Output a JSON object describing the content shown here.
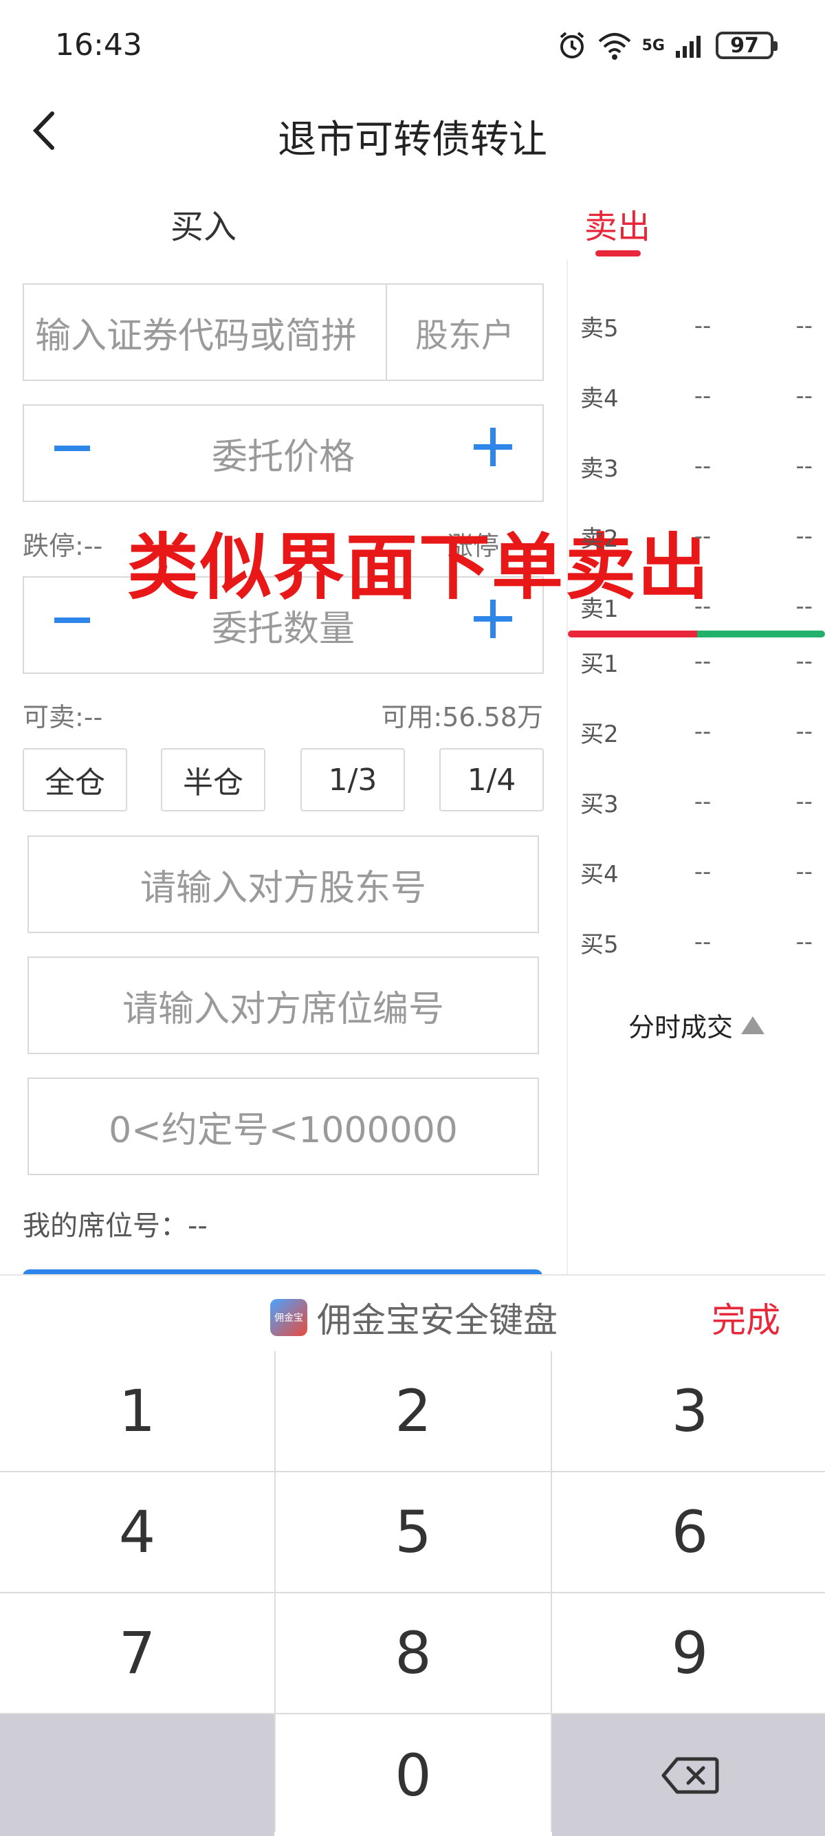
{
  "status_bar": {
    "time": "16:43",
    "network": "5G",
    "battery": "97"
  },
  "header": {
    "title": "退市可转债转让"
  },
  "tabs": [
    {
      "label": "买入"
    },
    {
      "label": "卖出"
    }
  ],
  "form": {
    "code_placeholder": "输入证券代码或简拼",
    "holder_account": "股东户",
    "price_placeholder": "委托价格",
    "quantity_placeholder": "委托数量",
    "limit_down": "跌停:--",
    "limit_up": "涨停",
    "sellable": "可卖:--",
    "available": "可用:56.58万",
    "ratios": [
      "全仓",
      "半仓",
      "1/3",
      "1/4"
    ],
    "counterparty_holder_placeholder": "请输入对方股东号",
    "counterparty_seat_placeholder": "请输入对方席位编号",
    "agreement_placeholder": "0<约定号<1000000",
    "my_seat": "我的席位号：--"
  },
  "overlay_text": "类似界面下单卖出",
  "order_book": {
    "asks": [
      {
        "label": "卖5",
        "price": "--",
        "volume": "--"
      },
      {
        "label": "卖4",
        "price": "--",
        "volume": "--"
      },
      {
        "label": "卖3",
        "price": "--",
        "volume": "--"
      },
      {
        "label": "卖2",
        "price": "--",
        "volume": "--"
      },
      {
        "label": "卖1",
        "price": "--",
        "volume": "--"
      }
    ],
    "bids": [
      {
        "label": "买1",
        "price": "--",
        "volume": "--"
      },
      {
        "label": "买2",
        "price": "--",
        "volume": "--"
      },
      {
        "label": "买3",
        "price": "--",
        "volume": "--"
      },
      {
        "label": "买4",
        "price": "--",
        "volume": "--"
      },
      {
        "label": "买5",
        "price": "--",
        "volume": "--"
      }
    ],
    "trades_label": "分时成交"
  },
  "keyboard": {
    "brand": "佣金宝安全键盘",
    "logo_text": "佣金宝",
    "done": "完成",
    "keys": [
      "1",
      "2",
      "3",
      "4",
      "5",
      "6",
      "7",
      "8",
      "9",
      "",
      "0",
      ""
    ]
  },
  "colors": {
    "accent_red": "#e8283a",
    "accent_blue": "#2f86ea",
    "bid_green": "#22b06a"
  }
}
